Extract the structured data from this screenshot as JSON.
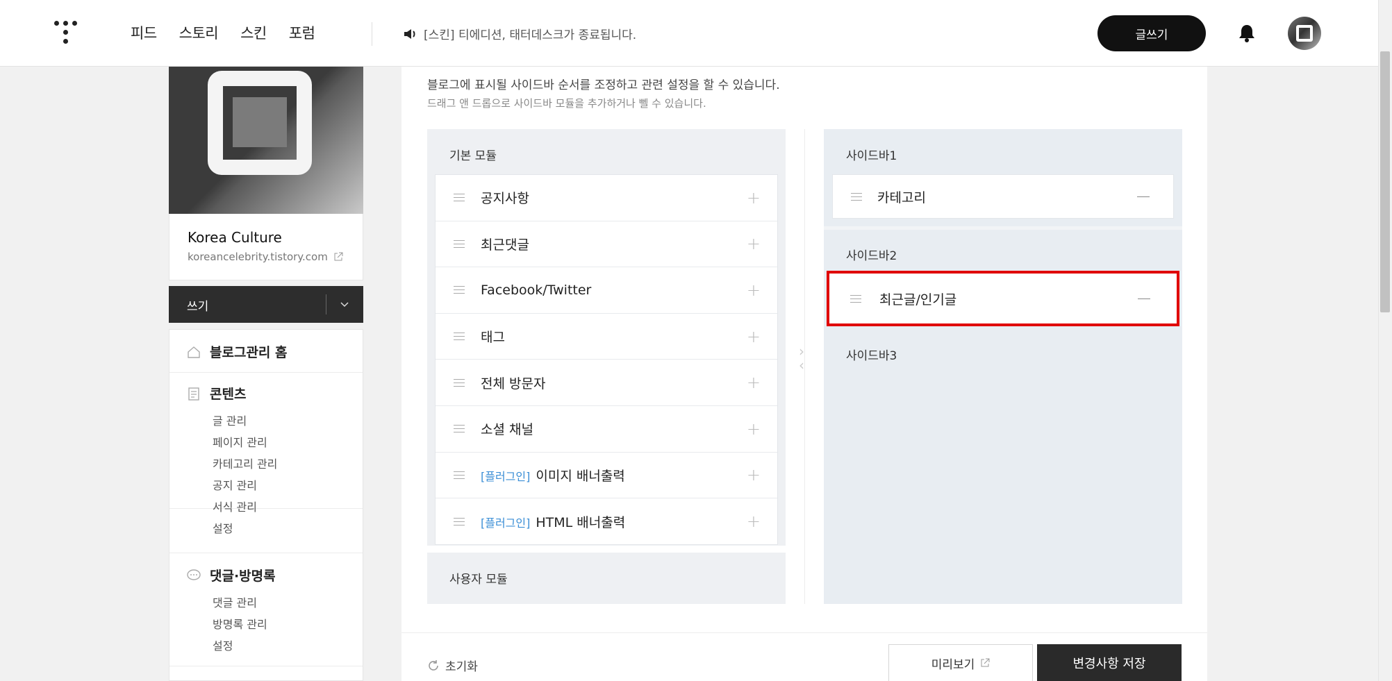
{
  "header": {
    "nav": [
      "피드",
      "스토리",
      "스킨",
      "포럼"
    ],
    "notice": "[스킨] 티에디션, 태터데스크가 종료됩니다.",
    "write_label": "글쓰기"
  },
  "blog": {
    "name": "Korea Culture",
    "url": "koreancelebrity.tistory.com"
  },
  "write_bar": {
    "label": "쓰기"
  },
  "menu": {
    "home": "블로그관리 홈",
    "contents": {
      "title": "콘텐츠",
      "items": [
        "글 관리",
        "페이지 관리",
        "카테고리 관리",
        "공지 관리",
        "서식 관리",
        "설정"
      ]
    },
    "comments": {
      "title": "댓글·방명록",
      "items": [
        "댓글 관리",
        "방명록 관리",
        "설정"
      ]
    }
  },
  "main": {
    "desc1": "블로그에 표시될 사이드바 순서를 조정하고 관련 설정을 할 수 있습니다.",
    "desc2": "드래그 앤 드롭으로 사이드바 모듈을 추가하거나 뻴 수 있습니다.",
    "basic_modules_title": "기본 모듈",
    "basic_modules": [
      {
        "plugin": "",
        "label": "공지사항"
      },
      {
        "plugin": "",
        "label": "최근댓글"
      },
      {
        "plugin": "",
        "label": "Facebook/Twitter"
      },
      {
        "plugin": "",
        "label": "태그"
      },
      {
        "plugin": "",
        "label": "전체 방문자"
      },
      {
        "plugin": "",
        "label": "소셜 채널"
      },
      {
        "plugin": "[플러그인]",
        "label": "이미지 배너출력"
      },
      {
        "plugin": "[플러그인]",
        "label": "HTML 배너출력"
      }
    ],
    "user_modules_title": "사용자 모듈",
    "sidebar1": {
      "title": "사이드바1",
      "items": [
        "카테고리"
      ]
    },
    "sidebar2": {
      "title": "사이드바2",
      "items": [
        "최근글/인기글"
      ]
    },
    "sidebar3": {
      "title": "사이드바3"
    }
  },
  "footer": {
    "reset": "초기화",
    "preview": "미리보기",
    "save": "변경사항 저장"
  },
  "colors": {
    "highlight": "#e00000",
    "plugin_tag": "#3a8ed6",
    "primary_dark": "#2a2a2a"
  }
}
